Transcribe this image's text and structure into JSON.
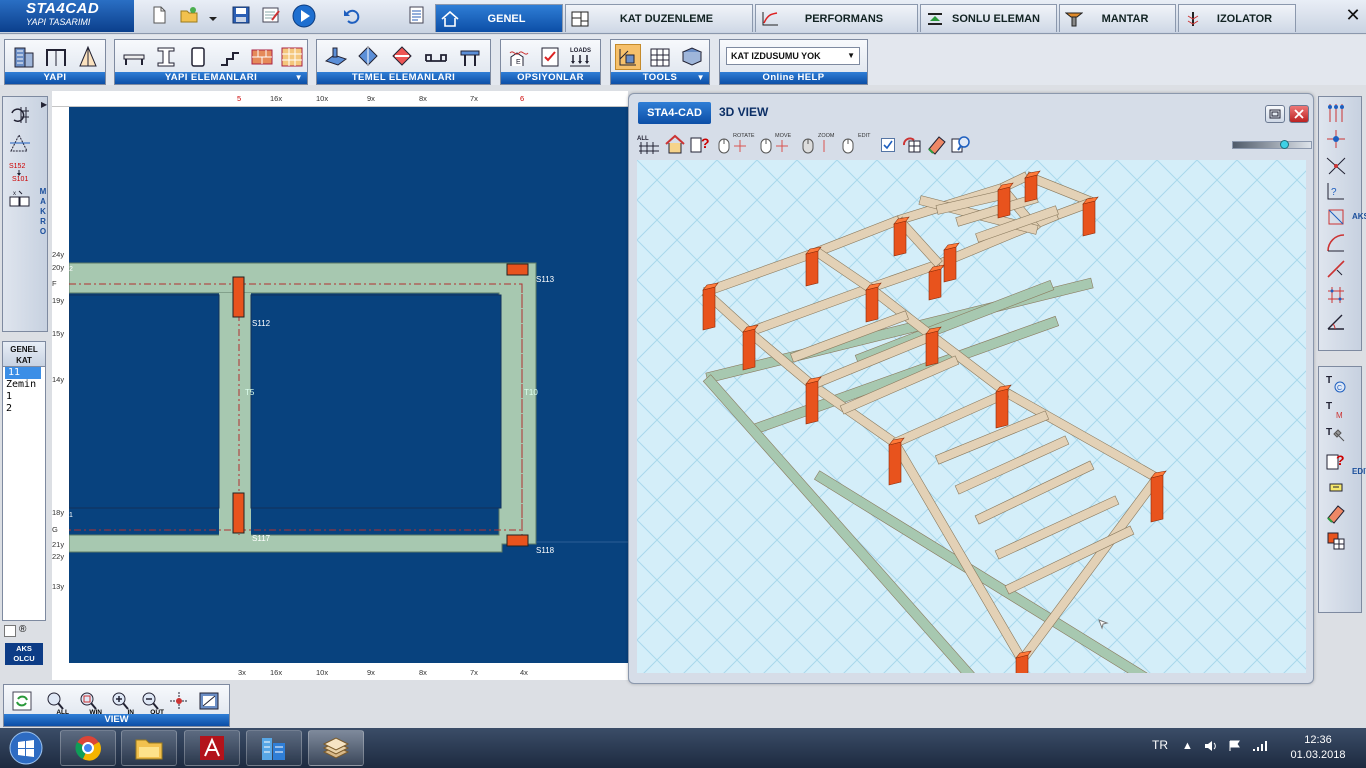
{
  "app": {
    "title": "STA4CAD",
    "subtitle": "YAPI TASARIMI"
  },
  "tabs": [
    {
      "label": "GENEL",
      "icon": "home-icon",
      "active": true
    },
    {
      "label": "KAT DUZENLEME",
      "icon": "floor-plan-icon",
      "active": false
    },
    {
      "label": "PERFORMANS",
      "icon": "chart-icon",
      "active": false
    },
    {
      "label": "SONLU ELEMAN",
      "icon": "finite-element-icon",
      "active": false
    },
    {
      "label": "MANTAR",
      "icon": "mushroom-slab-icon",
      "active": false
    },
    {
      "label": "IZOLATOR",
      "icon": "isolator-icon",
      "active": false
    }
  ],
  "ribbon": {
    "groups": {
      "yapi": "YAPI",
      "yapi_elemanlari": "YAPI ELEMANLARI",
      "temel_elemanlari": "TEMEL ELEMANLARI",
      "opsiyonlar": "OPSIYONLAR",
      "tools": "TOOLS",
      "online_help": "Online HELP"
    },
    "loads_label": "LOADS",
    "kat_izdusumu": "KAT IZDUSUMU YOK"
  },
  "left": {
    "makro_label": "MAKRO",
    "s152": "S152",
    "s101": "S101",
    "kat_header": [
      "GENEL",
      "KAT"
    ],
    "kat_items": [
      "11",
      "Zemin",
      "1",
      "2"
    ],
    "selected_index": 0,
    "reg_symbol": "®",
    "aks_olcu": [
      "AKS",
      "OLCU"
    ]
  },
  "plan": {
    "top_ruler": [
      "5",
      "16x",
      "10x",
      "9x",
      "8x",
      "7x",
      "6"
    ],
    "bottom_ruler": [
      "3x",
      "16x",
      "10x",
      "9x",
      "8x",
      "7x",
      "4x"
    ],
    "left_ruler": [
      "24y",
      "20y",
      "F",
      "19y",
      "15y",
      "14y",
      "18y",
      "G",
      "21y",
      "22y",
      "13y"
    ],
    "axis_marks": {
      "top_left": "2",
      "bottom_left": "1"
    },
    "column_labels": [
      "S113",
      "S112",
      "S118",
      "S117"
    ],
    "beam_labels": [
      "T5",
      "T10"
    ]
  },
  "view3d": {
    "badge": "STA4-CAD",
    "title": "3D VIEW",
    "mouse_labels": [
      "ROTATE",
      "MOVE",
      "ZOOM",
      "EDIT"
    ],
    "checkbox_checked": true,
    "slider_level": 0.65
  },
  "right": {
    "aks_label": "AKS",
    "edit_label": "EDIT"
  },
  "viewbar": {
    "label": "VIEW",
    "sub": [
      "ALL",
      "WIN",
      "IN",
      "OUT"
    ]
  },
  "taskbar": {
    "lang": "TR",
    "time": "12:36",
    "date": "01.03.2018",
    "apps": [
      "chrome-icon",
      "file-explorer-icon",
      "autocad-icon",
      "building-app-icon",
      "sta4cad-icon"
    ]
  },
  "colors": {
    "accent": "#0c4ea6",
    "plan_bg": "#08427e",
    "slab_green": "#a7c8b0",
    "column_orange": "#e8531d",
    "beam_tan": "#e3d1b6",
    "sky_grid": "#d4eef9"
  }
}
